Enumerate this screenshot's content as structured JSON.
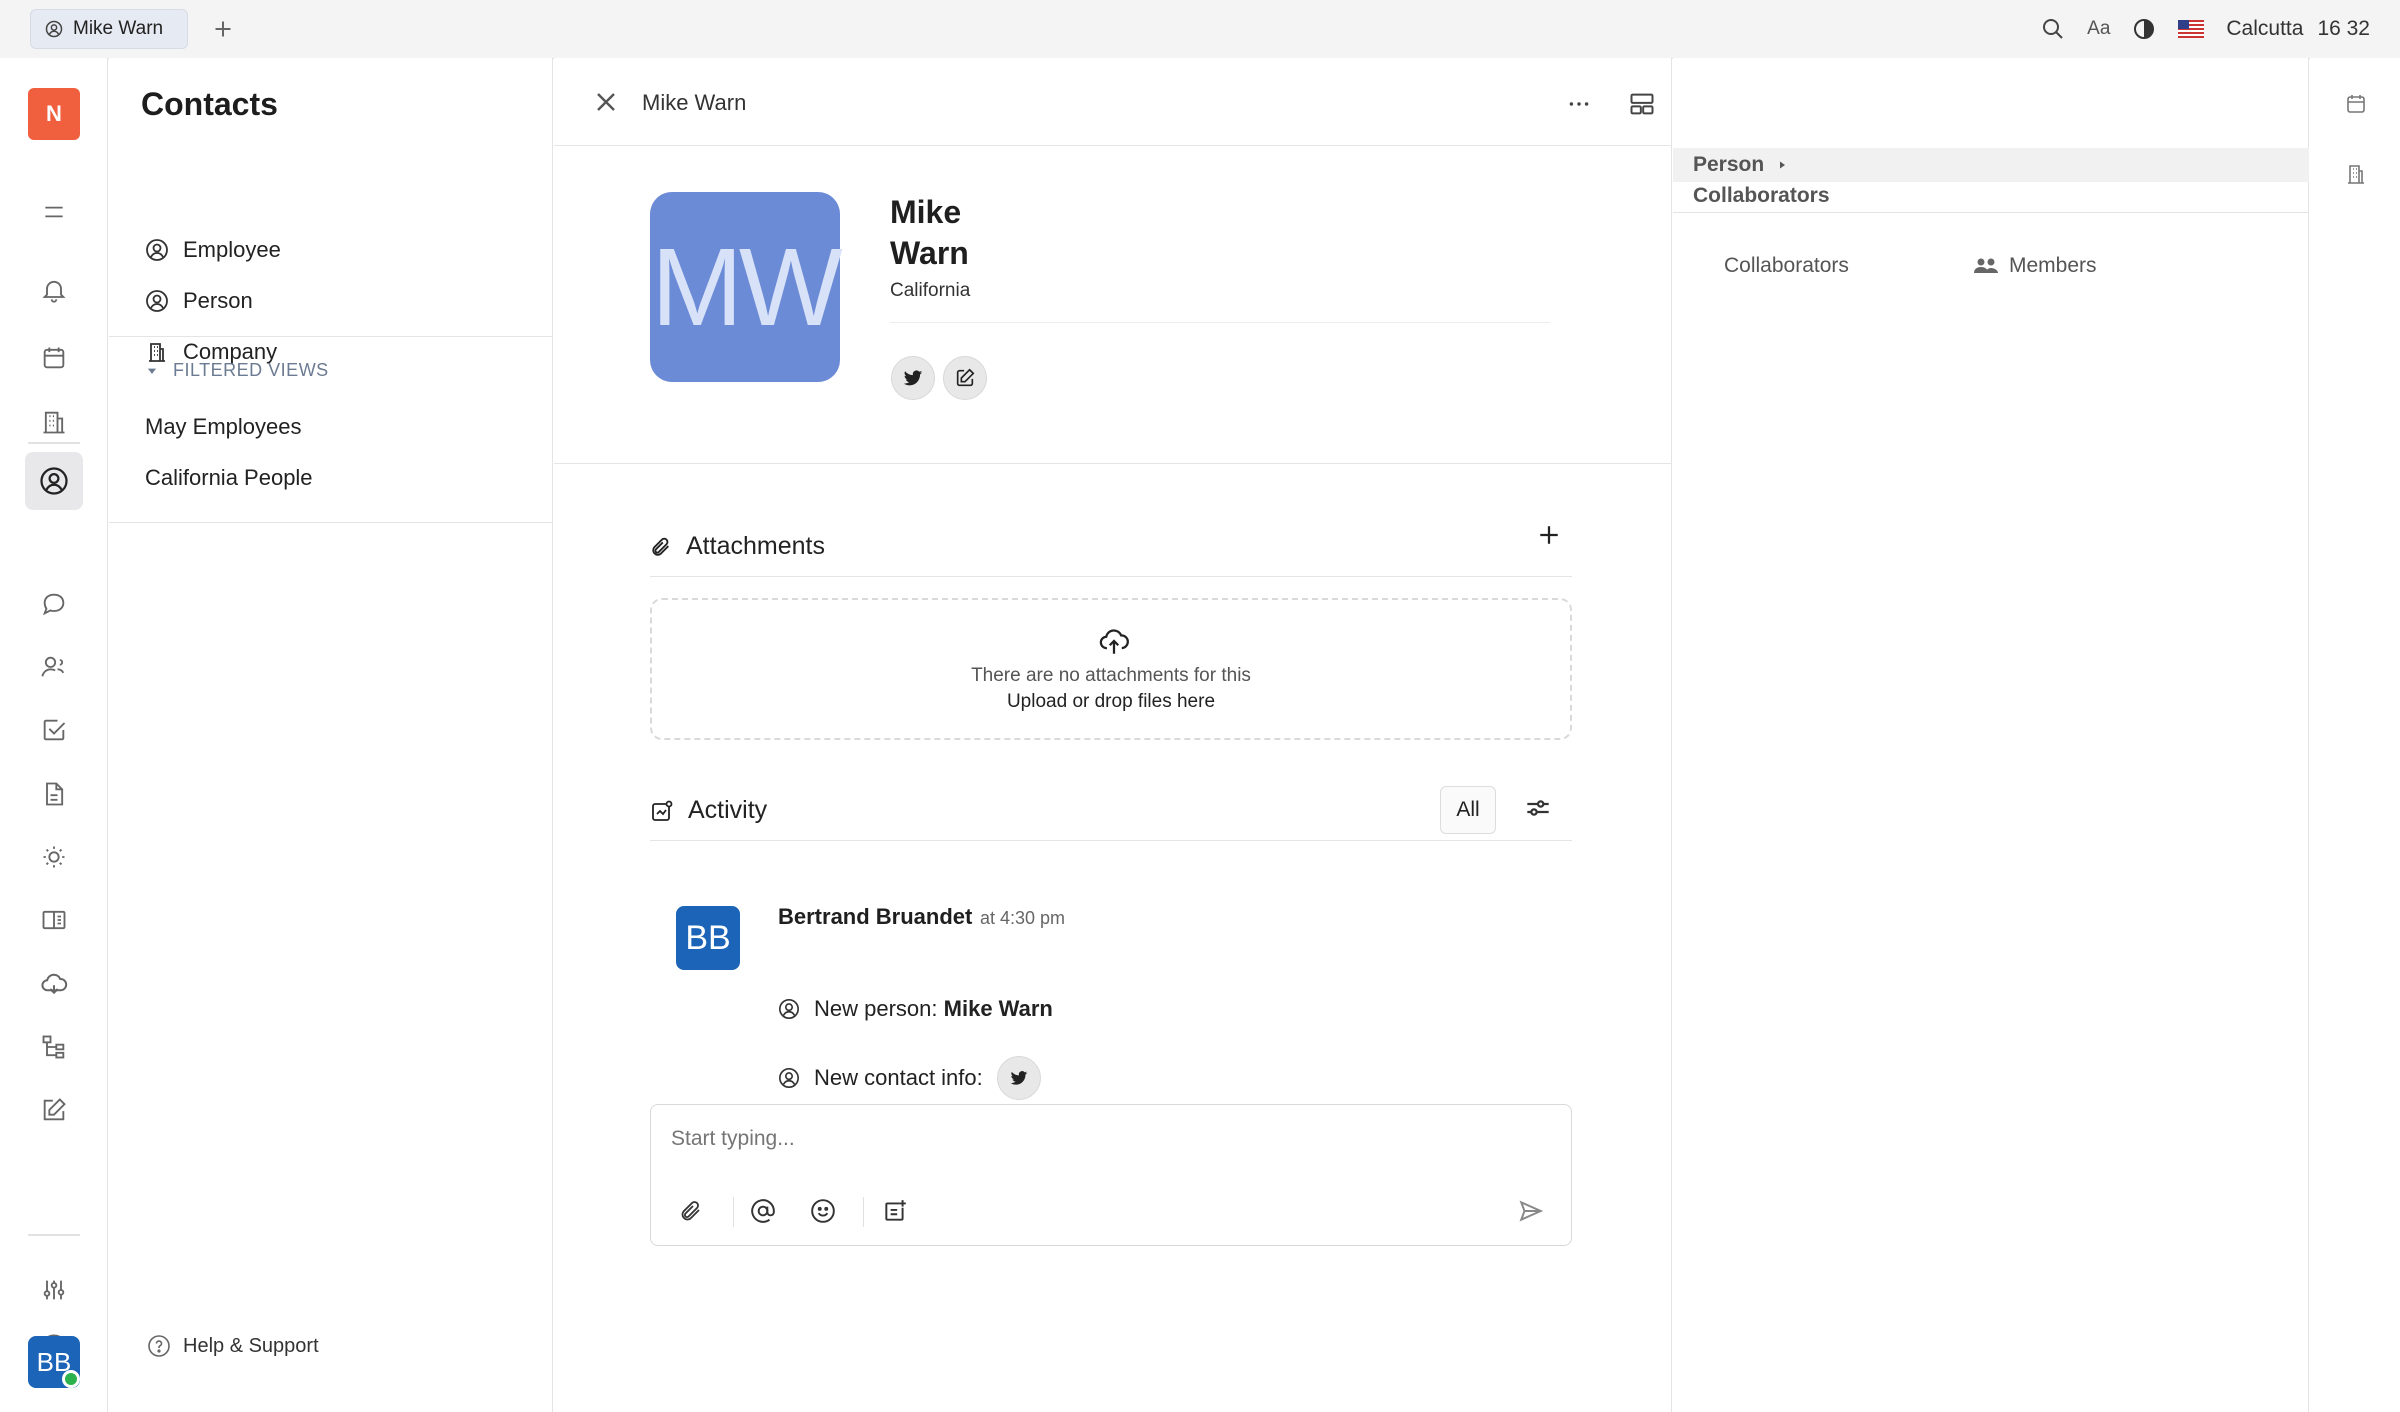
{
  "topbar": {
    "tab_label": "Mike Warn",
    "font_size_label": "Aa",
    "city": "Calcutta",
    "time": "16 32"
  },
  "rail": {
    "workspace_initial": "N",
    "user_initials": "BB"
  },
  "nav": {
    "title": "Contacts",
    "items": [
      {
        "label": "Employee",
        "icon": "person-circle-icon"
      },
      {
        "label": "Person",
        "icon": "person-circle-icon"
      },
      {
        "label": "Company",
        "icon": "building-icon"
      }
    ],
    "filtered_views_label": "FILTERED VIEWS",
    "filtered_views": [
      "May Employees",
      "California People"
    ],
    "help_label": "Help & Support"
  },
  "detail": {
    "header_title": "Mike Warn",
    "avatar_initials": "MW",
    "first_name": "Mike",
    "last_name": "Warn",
    "location": "California",
    "attachments": {
      "title": "Attachments",
      "empty_text": "There are no attachments for this",
      "upload_text": "Upload or drop files here"
    },
    "activity": {
      "title": "Activity",
      "filter_label": "All",
      "entry": {
        "avatar_initials": "BB",
        "author": "Bertrand Bruandet",
        "time": "at 4:30 pm",
        "line1_prefix": "New person:",
        "line1_value": "Mike Warn",
        "line2_prefix": "New contact info:"
      }
    },
    "composer_placeholder": "Start typing..."
  },
  "side": {
    "breadcrumb": "Person",
    "section": "Collaborators",
    "collaborators_label": "Collaborators",
    "members_label": "Members"
  },
  "colors": {
    "workspace": "#f0603f",
    "user_avatar": "#1b64b8",
    "contact_avatar": "#6b8bd6",
    "online": "#2bb24c"
  }
}
